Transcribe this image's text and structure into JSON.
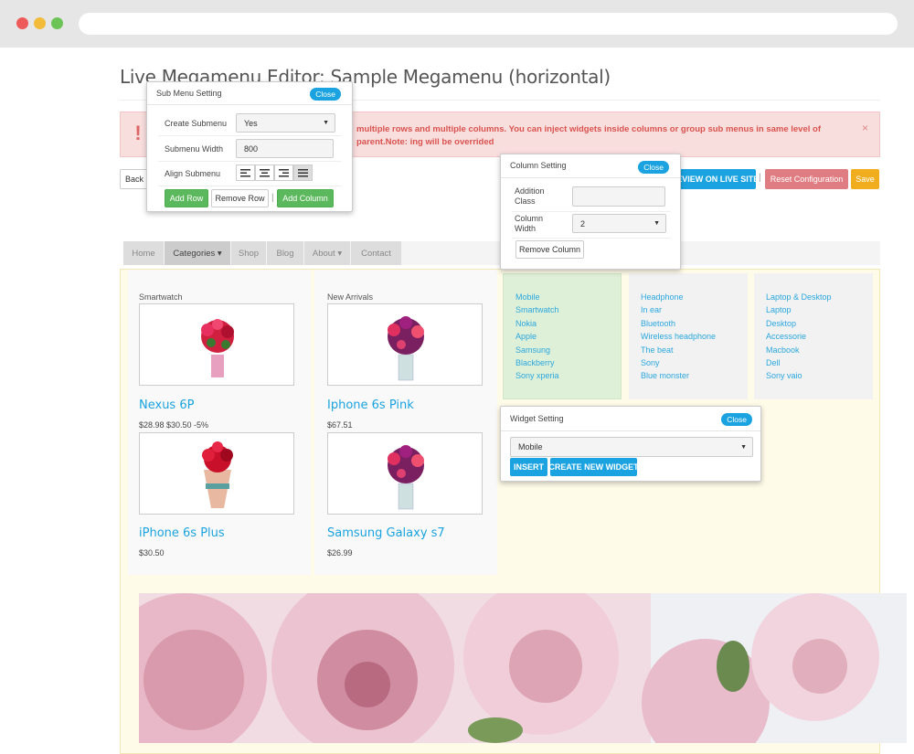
{
  "page": {
    "title": "Live Megamenu Editor: Sample Megamenu (horizontal)",
    "alert_text": "multiple rows and multiple columns. You can inject widgets inside columns or group sub menus in same level of parent.Note: ing will be overrided",
    "alert_icon": "warning-icon",
    "alert_close": "×"
  },
  "toolbar": {
    "back_label": "Back",
    "preview_label": "REVIEW ON LIVE SITE",
    "reset_label": "Reset Configuration",
    "save_label": "Save",
    "separator": "|"
  },
  "menu": {
    "items": [
      "Home",
      "Categories ▾",
      "Shop",
      "Blog",
      "About ▾",
      "Contact"
    ]
  },
  "products": {
    "col1_label": "Smartwatch",
    "col2_label": "New Arrivals",
    "items": [
      {
        "name": "Nexus 6P",
        "price": "$28.98 $30.50 -5%"
      },
      {
        "name": "Iphone 6s Pink",
        "price": "$67.51"
      },
      {
        "name": "iPhone 6s Plus",
        "price": "$30.50"
      },
      {
        "name": "Samsung Galaxy s7",
        "price": "$26.99"
      }
    ]
  },
  "link_columns": [
    [
      "Mobile",
      "Smartwatch",
      "Nokia",
      "Apple",
      "Samsung",
      "Blackberry",
      "Sony xperia"
    ],
    [
      "Headphone",
      "In ear",
      "Bluetooth",
      "Wireless headphone",
      "The beat",
      "Sony",
      "Blue monster"
    ],
    [
      "Laptop & Desktop",
      "Laptop",
      "Desktop",
      "Accessorie",
      "Macbook",
      "Dell",
      "Sony vaio"
    ]
  ],
  "submenu_panel": {
    "title": "Sub Menu Setting",
    "close_label": "Close",
    "create_label": "Create Submenu",
    "create_value": "Yes",
    "width_label": "Submenu Width",
    "width_value": "800",
    "align_label": "Align Submenu",
    "add_row_label": "Add Row",
    "remove_row_label": "Remove Row",
    "add_column_label": "Add Column",
    "separator": "|"
  },
  "column_panel": {
    "title": "Column Setting",
    "close_label": "Close",
    "class_label": "Addition Class",
    "class_value": "",
    "width_label": "Column Width",
    "width_value": "2",
    "remove_label": "Remove Column"
  },
  "widget_panel": {
    "title": "Widget Setting",
    "close_label": "Close",
    "widget_value": "Mobile",
    "insert_label": "INSERT",
    "create_label": "CREATE NEW WIDGET"
  },
  "colors": {
    "accent": "#1aa3e0",
    "green": "#5cb85c",
    "danger": "#d9534f",
    "warning": "#f0ad1e"
  }
}
